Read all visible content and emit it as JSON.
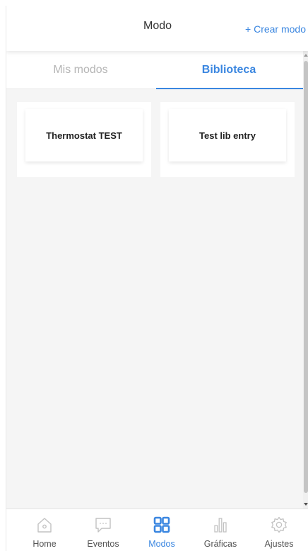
{
  "header": {
    "title": "Modo",
    "create_label": "+ Crear modo"
  },
  "tabs": [
    {
      "label": "Mis modos",
      "active": false
    },
    {
      "label": "Biblioteca",
      "active": true
    }
  ],
  "cards": [
    {
      "label": "Thermostat TEST"
    },
    {
      "label": "Test lib entry"
    }
  ],
  "bottom_nav": [
    {
      "label": "Home",
      "icon": "home-icon",
      "active": false
    },
    {
      "label": "Eventos",
      "icon": "chat-bubble-icon",
      "active": false
    },
    {
      "label": "Modos",
      "icon": "grid-icon",
      "active": true
    },
    {
      "label": "Gráficas",
      "icon": "bar-chart-icon",
      "active": false
    },
    {
      "label": "Ajustes",
      "icon": "gear-icon",
      "active": false
    }
  ],
  "colors": {
    "accent": "#3a86e0",
    "inactive_text": "#b5b5b5",
    "background": "#f5f5f5",
    "icon_inactive": "#c2c2c2"
  }
}
